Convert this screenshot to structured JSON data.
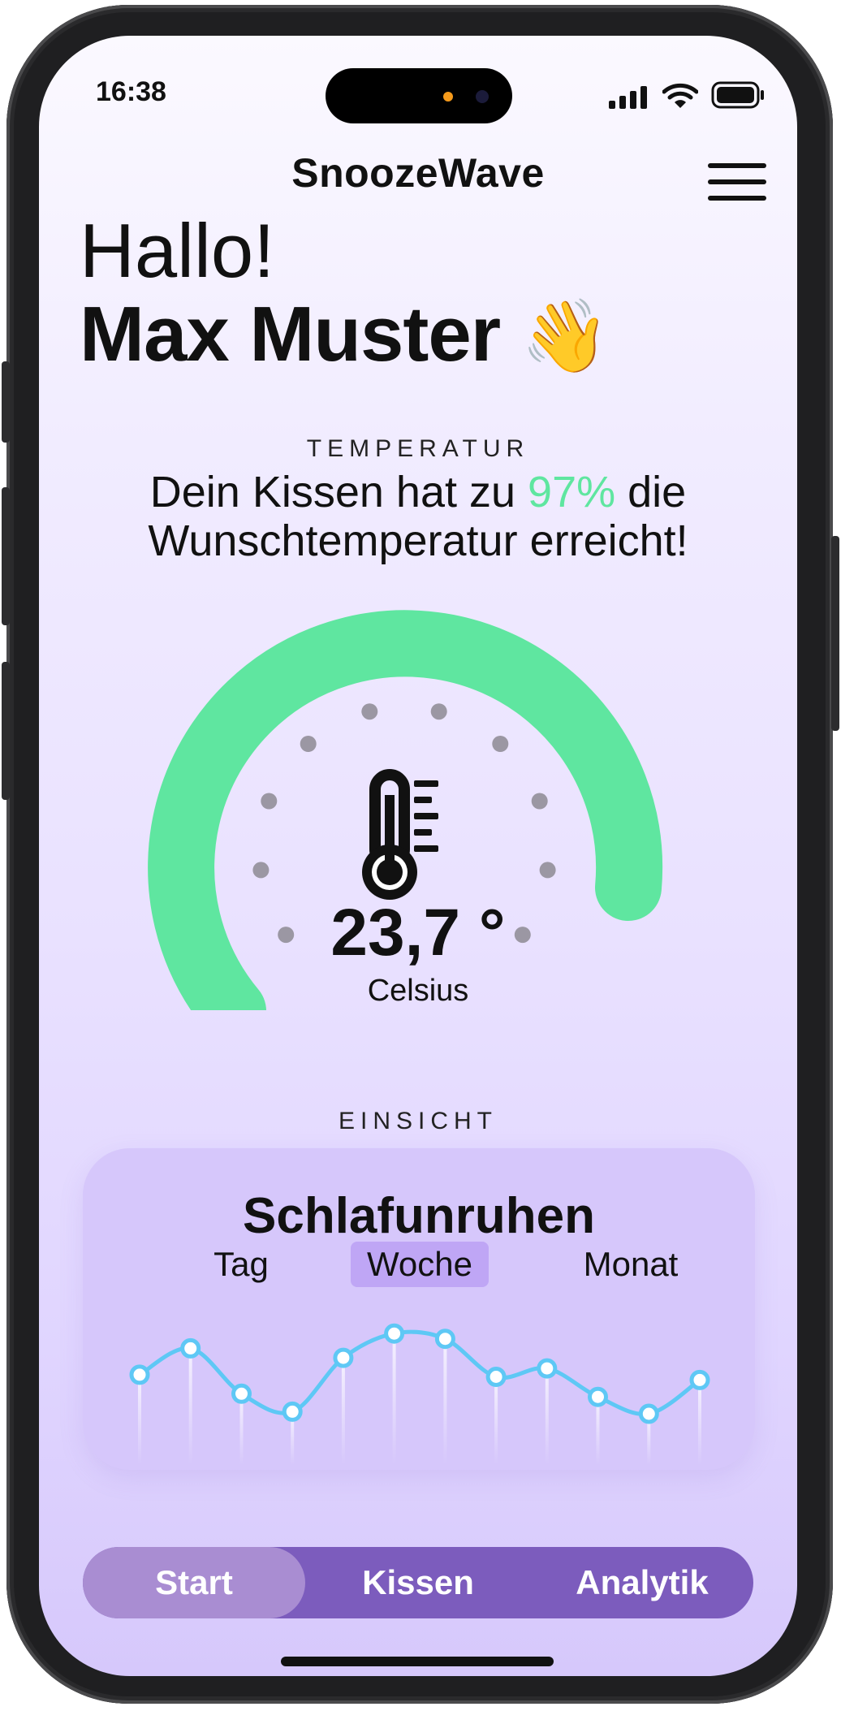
{
  "status_bar": {
    "time": "16:38"
  },
  "app": {
    "title": "SnoozeWave"
  },
  "greeting": {
    "hello": "Hallo!",
    "name": "Max Muster",
    "wave_emoji": "👋"
  },
  "temperature": {
    "section_label": "TEMPERATUR",
    "message_prefix": "Dein Kissen hat zu ",
    "percent": "97%",
    "message_suffix_line1": " die",
    "message_line2": "Wunschtemperatur erreicht!",
    "percent_value": 0.97,
    "value": "23,7 °",
    "unit": "Celsius",
    "thermometer_icon": "thermometer-icon"
  },
  "insight": {
    "section_label": "EINSICHT",
    "title": "Schlafunruhen",
    "periods": [
      "Tag",
      "Woche",
      "Monat"
    ],
    "selected_period": "Woche"
  },
  "tabs": {
    "items": [
      "Start",
      "Kissen",
      "Analytik"
    ],
    "selected": "Start"
  },
  "colors": {
    "accent_green": "#5fe6a0",
    "tab_bar": "#7c5cbd",
    "tab_active": "#a98dd2",
    "card": "#d6c7fb",
    "line": "#5ec8f5",
    "tick_dot": "#9b97a3"
  },
  "chart_data": {
    "type": "line",
    "series": [
      {
        "values": [
          47,
          72,
          29,
          12,
          63,
          86,
          81,
          45,
          53,
          26,
          10,
          42
        ]
      }
    ],
    "ylim": [
      0,
      100
    ]
  }
}
